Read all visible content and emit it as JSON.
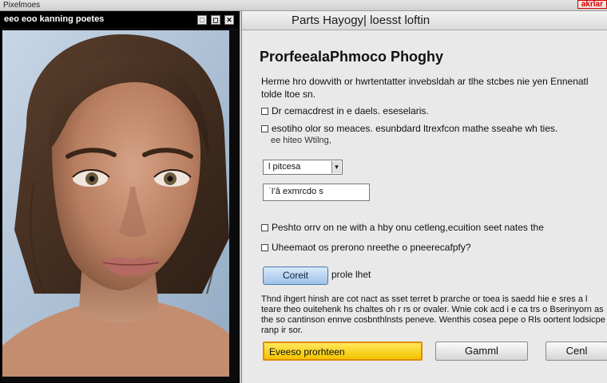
{
  "window": {
    "app_title": "Pixelmoes",
    "right_tag": "akrlar"
  },
  "viewer": {
    "title": "eeo eoo kanning poetes",
    "min_icon": "□",
    "max_icon": "◻",
    "close_icon": "✕"
  },
  "dialog": {
    "title": "Parts Hayogy| loesst loftin",
    "heading": "ProrfeealaPhmoco Phoghy",
    "description": "Herme hro dowvith or hwrtentatter invebsldah ar tlhe stcbes nie yen Ennenatl tolde ltoe sn.",
    "check_1": "Dr cemacdrest in e daels. eseselaris.",
    "check_2": "esotiho olor so meaces. esunbdard ltrexfcon mathe sseahe wh ties.",
    "subnote": "ee hiteo Wtilng,",
    "select_value": "l pitcesa",
    "select_arrow": "▾",
    "input_value": "ˈI'â exmrcdo s",
    "check_3": "Peshto orrv on ne with a hby onu cetleng,ecuition seet nates the",
    "check_4": "Uheemaot os prerono nreethe o pneerecafpfy?",
    "pill_button": "Coreit",
    "pill_note": "prole lhet",
    "info": "Thnd ihgert hinsh are cot nact as sset terret b prarche or toea is saedd hie e sres a l teare theo ouitehenk hs chaltes oh r rs or ovaler. Wnie cok acd i e ca trs o Bserinyorn as the so cantinson ennve cosbnthlnsts peneve. Wenthis cosea pepe o Rls oortent lodsicpe ranp ir sor.",
    "primary_button": "Eveeso prorhteen",
    "secondary_button": "Gamml",
    "tertiary_button": "Cenl"
  }
}
